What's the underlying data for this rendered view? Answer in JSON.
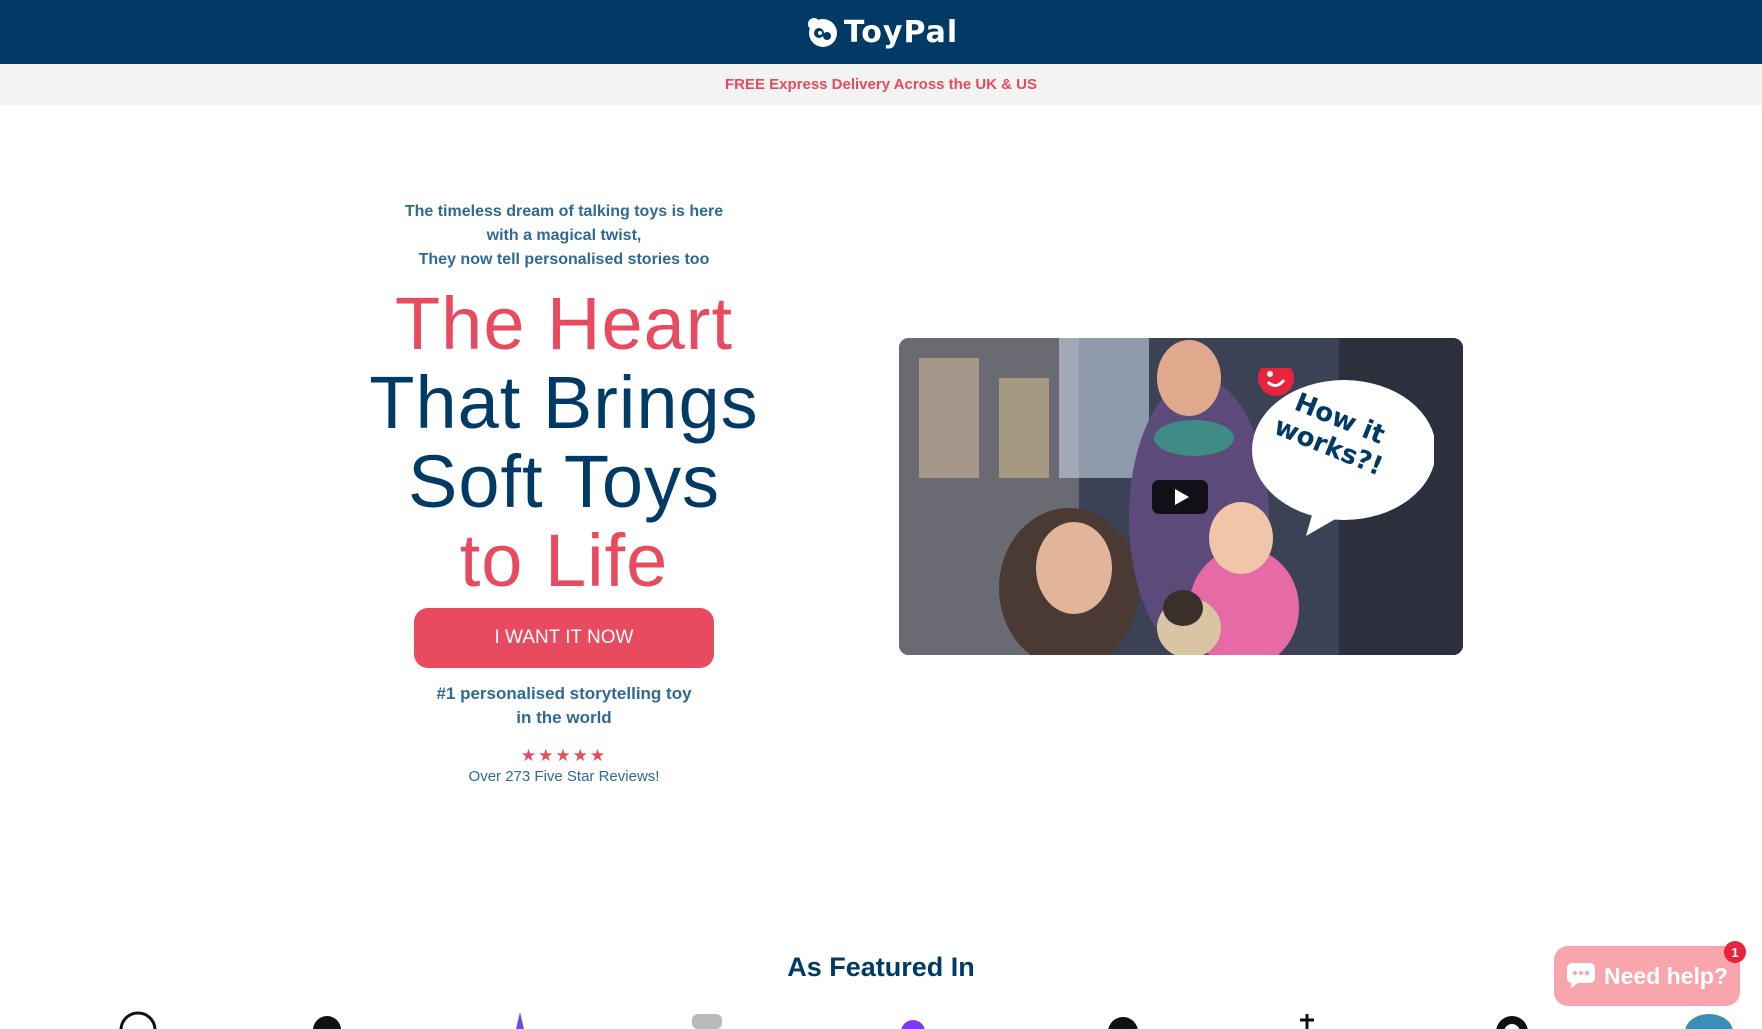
{
  "header": {
    "logo_text": "ToyPal",
    "logo_icon": "toypal-logo-icon",
    "background": "#003a65"
  },
  "announcement": {
    "text": "FREE Express Delivery Across the UK & US",
    "color": "#e84a5f"
  },
  "hero": {
    "tagline_lines": [
      "The timeless dream of talking toys is here",
      "with a magical twist,",
      "They now tell personalised stories too"
    ],
    "headline": {
      "line1": "The Heart",
      "line2": "That Brings",
      "line3": "Soft Toys",
      "line4": "to Life"
    },
    "cta_label": "I WANT IT NOW",
    "subline_lines": [
      "#1 personalised storytelling toy",
      "in the world"
    ],
    "stars": "★★★★★",
    "reviews_text": "Over 273 Five Star Reviews!"
  },
  "video": {
    "bubble_text_line1": "How it",
    "bubble_text_line2": "works?!",
    "play_icon": "play-icon"
  },
  "featured": {
    "title": "As Featured In"
  },
  "chat": {
    "label": "Need help?",
    "badge": "1",
    "icon": "chat-bubble-icon"
  },
  "colors": {
    "navy": "#003a65",
    "pink": "#e84a5f",
    "muted_blue": "#2f6a94",
    "chat_pink": "#f9a5ac"
  }
}
